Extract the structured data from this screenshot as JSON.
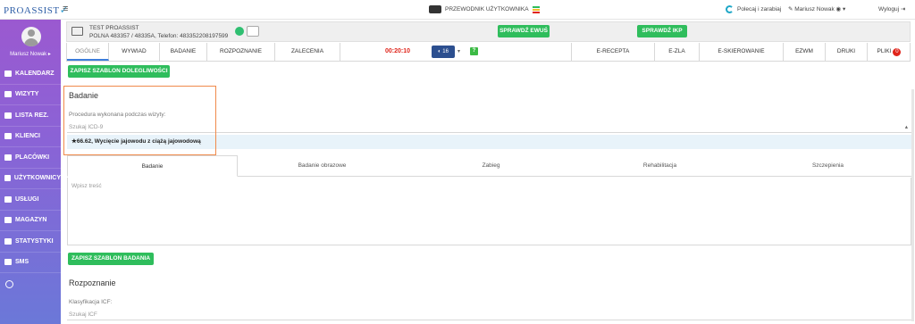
{
  "topbar": {
    "logo": "PROASSIST",
    "guide": "PRZEWODNIK UŻYTKOWNIKA",
    "recommend": "Polecaj i zarabiaj",
    "user": "Mariusz Nowak",
    "logout": "Wyloguj"
  },
  "sidebar": {
    "user_name": "Mariusz Nowak",
    "items": [
      {
        "label": "KALENDARZ"
      },
      {
        "label": "WIZYTY"
      },
      {
        "label": "LISTA REZ."
      },
      {
        "label": "KLIENCI"
      },
      {
        "label": "PLACÓWKI"
      },
      {
        "label": "UŻYTKOWNICY"
      },
      {
        "label": "USŁUGI"
      },
      {
        "label": "MAGAZYN"
      },
      {
        "label": "STATYSTYKI"
      },
      {
        "label": "SMS"
      }
    ]
  },
  "patient": {
    "name": "TEST PROASSIST",
    "address": "POLNA 483357 / 48335A, Telefon: 483352208197599",
    "ewus_button": "SPRAWDŹ EWUŚ",
    "ikp_button": "SPRAWDŹ IKP"
  },
  "tabs": {
    "ogolne": "OGÓLNE",
    "wywiad": "WYWIAD",
    "badanie": "BADANIE",
    "rozpoznanie": "ROZPOZNANIE",
    "zalecenia": "ZALECENIA",
    "timer": "00:20:10",
    "speed": "16",
    "erecepta": "E-RECEPTA",
    "ezla": "E-ZLA",
    "eskierowanie": "E-SKIEROWANIE",
    "ezwm": "EZWM",
    "druki": "DRUKI",
    "pliki": "PLIKI",
    "pliki_count": "0"
  },
  "main": {
    "save_complaint": "ZAPISZ SZABLON DOLEGLIWOŚCI",
    "section_badanie": "Badanie",
    "procedure_label": "Procedura wykonana podczas wizyty:",
    "icd_placeholder": "Szukaj ICD-9",
    "selected_procedure": "★66.62, Wycięcie jajowodu z ciążą jajowodową",
    "subtabs": [
      "Badanie",
      "Badanie obrazowe",
      "Zabieg",
      "Rehabilitacja",
      "Szczepienia"
    ],
    "textarea_placeholder": "Wpisz treść",
    "save_exam": "ZAPISZ SZABLON BADANIA",
    "section_rozpoznanie": "Rozpoznanie",
    "icf_label": "Klasyfikacja ICF:",
    "icf_placeholder": "Szukaj ICF"
  },
  "colors": {
    "accent_green": "#2fbd5c",
    "sidebar_top": "#9b59d0",
    "sidebar_bottom": "#6b78d8",
    "timer_red": "#e0251b",
    "highlight_orange": "#f08a4b"
  }
}
